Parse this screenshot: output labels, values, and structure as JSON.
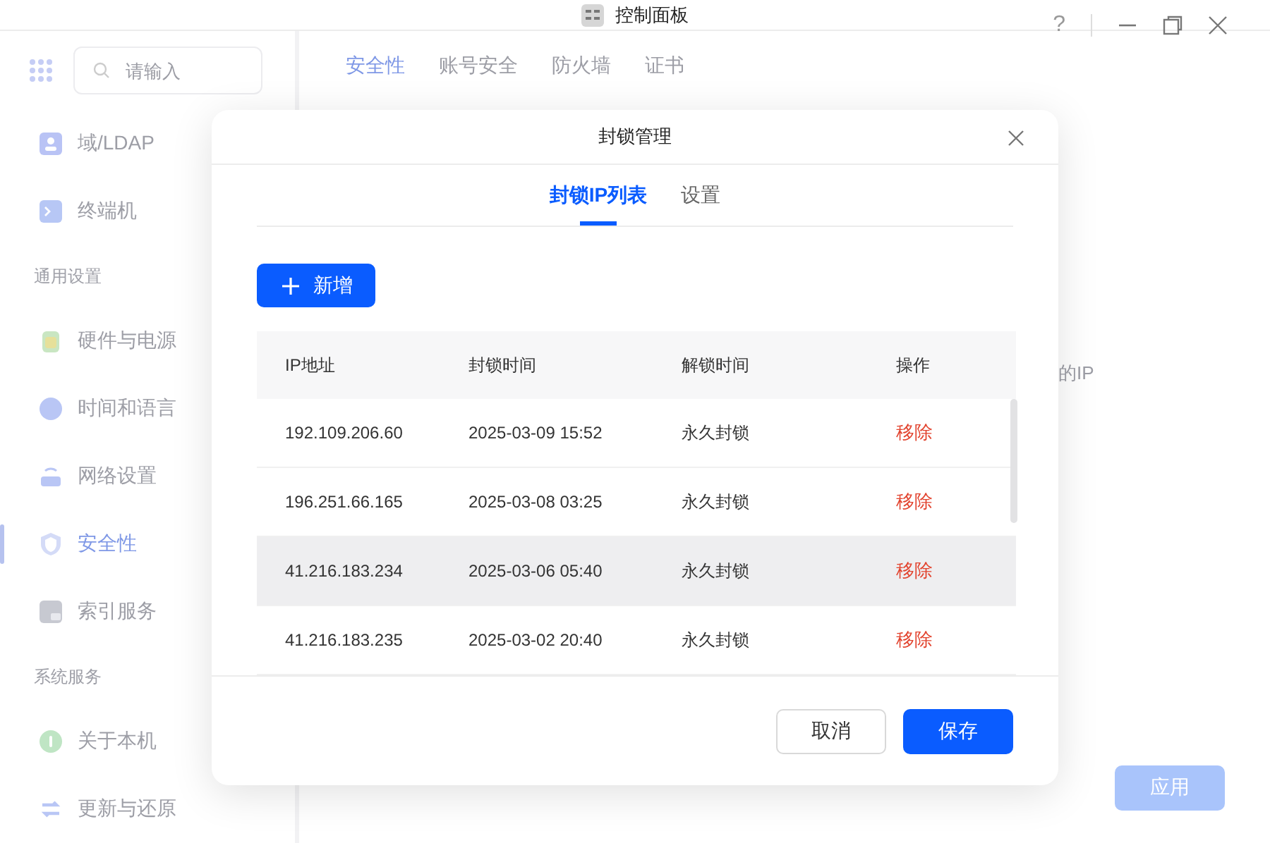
{
  "window": {
    "title": "控制面板",
    "help": "?"
  },
  "sidebar": {
    "search": {
      "placeholder": "请输入"
    },
    "groups": [
      {
        "items": [
          {
            "label": "域/LDAP",
            "selected": false
          },
          {
            "label": "终端机",
            "selected": false
          }
        ]
      },
      {
        "heading": "通用设置",
        "items": [
          {
            "label": "硬件与电源",
            "selected": false
          },
          {
            "label": "时间和语言",
            "selected": false
          },
          {
            "label": "网络设置",
            "selected": false
          },
          {
            "label": "安全性",
            "selected": true
          },
          {
            "label": "索引服务",
            "selected": false
          }
        ]
      },
      {
        "heading": "系统服务",
        "items": [
          {
            "label": "关于本机",
            "selected": false
          },
          {
            "label": "更新与还原",
            "selected": false
          }
        ]
      }
    ]
  },
  "tabs": [
    {
      "label": "安全性",
      "selected": true
    },
    {
      "label": "账号安全",
      "selected": false
    },
    {
      "label": "防火墙",
      "selected": false
    },
    {
      "label": "证书",
      "selected": false
    }
  ],
  "hint_text": "的IP",
  "apply_button": {
    "label": "应用",
    "disabled": true
  },
  "dialog": {
    "title": "封锁管理",
    "tabs": [
      {
        "label": "封锁IP列表",
        "selected": true
      },
      {
        "label": "设置",
        "selected": false
      }
    ],
    "add_button": "新增",
    "table": {
      "columns": [
        "IP地址",
        "封锁时间",
        "解锁时间",
        "操作"
      ],
      "rows": [
        {
          "ip": "192.109.206.60",
          "blocked_at": "2025-03-09 15:52",
          "unblock_at": "永久封锁",
          "action": "移除",
          "highlighted": false
        },
        {
          "ip": "196.251.66.165",
          "blocked_at": "2025-03-08 03:25",
          "unblock_at": "永久封锁",
          "action": "移除",
          "highlighted": false
        },
        {
          "ip": "41.216.183.234",
          "blocked_at": "2025-03-06 05:40",
          "unblock_at": "永久封锁",
          "action": "移除",
          "highlighted": true
        },
        {
          "ip": "41.216.183.235",
          "blocked_at": "2025-03-02 20:40",
          "unblock_at": "永久封锁",
          "action": "移除",
          "highlighted": false
        }
      ]
    },
    "buttons": [
      {
        "label": "取消",
        "kind": "secondary"
      },
      {
        "label": "保存",
        "kind": "primary"
      }
    ]
  }
}
